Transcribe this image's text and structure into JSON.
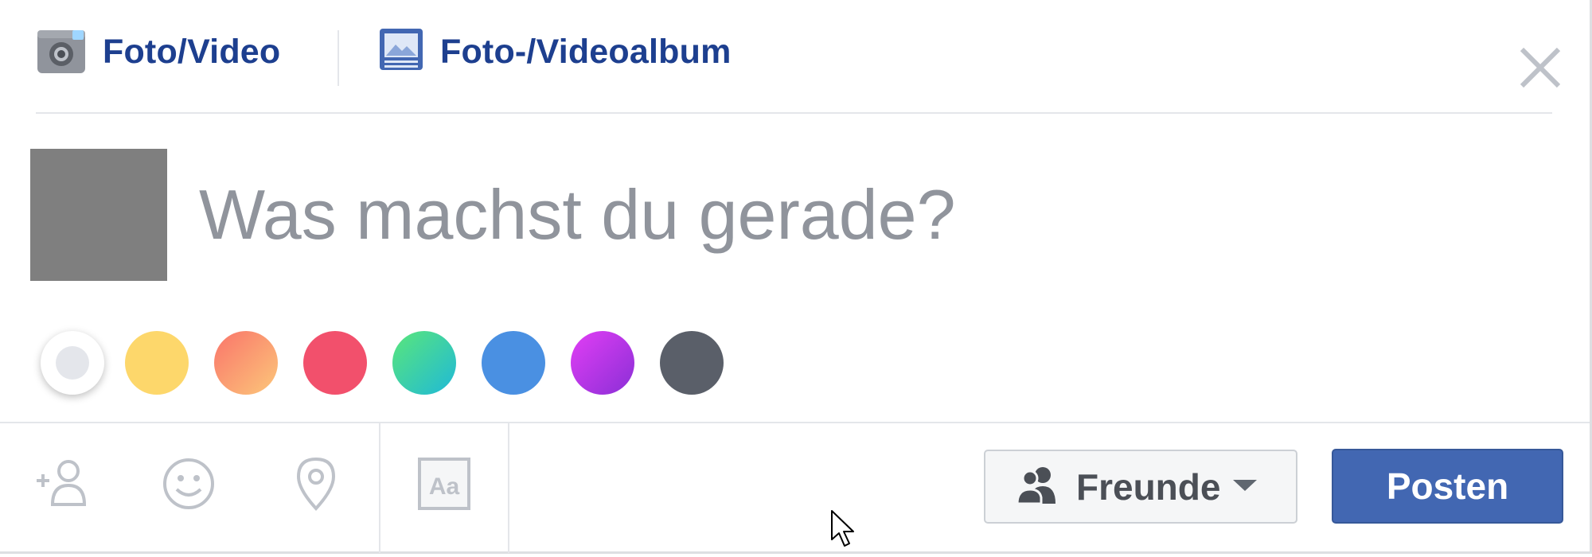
{
  "tabs": {
    "photo_video": {
      "label": "Foto/Video",
      "icon": "camera-icon"
    },
    "photo_album": {
      "label": "Foto-/Videoalbum",
      "icon": "photo-album-icon"
    }
  },
  "close": {
    "icon": "close-icon"
  },
  "status": {
    "placeholder": "Was machst du gerade?",
    "value": ""
  },
  "backgrounds": [
    {
      "name": "white",
      "color": "#ffffff",
      "selected": true
    },
    {
      "name": "yellow",
      "color": "#fdd76b"
    },
    {
      "name": "orange",
      "color": "#f98e58"
    },
    {
      "name": "red",
      "color": "#f2506c"
    },
    {
      "name": "green-teal",
      "color": "#44d7a2"
    },
    {
      "name": "blue",
      "color": "#4a90e2"
    },
    {
      "name": "purple",
      "color": "#c43fee"
    },
    {
      "name": "dark-gray",
      "color": "#5a5f69"
    }
  ],
  "toolbar": {
    "tag_friends": {
      "icon": "tag-friend-icon"
    },
    "feeling": {
      "icon": "smiley-icon"
    },
    "location": {
      "icon": "location-pin-icon"
    },
    "text_format": {
      "icon": "text-format-icon",
      "label": "Aa"
    }
  },
  "audience": {
    "label": "Freunde",
    "icon": "friends-icon"
  },
  "post": {
    "label": "Posten"
  },
  "colors": {
    "accent": "#4267b2",
    "tab_text": "#1d3f8f",
    "placeholder": "#90949c"
  }
}
